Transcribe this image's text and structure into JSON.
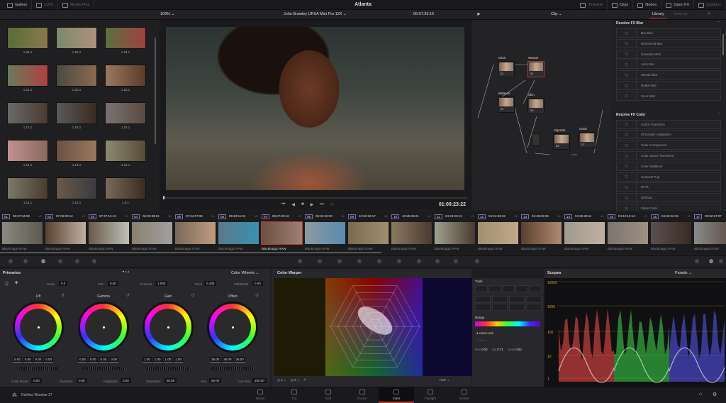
{
  "app": {
    "project_title": "Atlanta",
    "version_label": "DaVinci Resolve 17"
  },
  "top_left_tabs": [
    {
      "label": "Gallery",
      "icon": "gallery-icon"
    },
    {
      "label": "LUTs",
      "icon": "luts-icon"
    },
    {
      "label": "Media Pool",
      "icon": "media-pool-icon"
    }
  ],
  "top_right_tabs": [
    {
      "label": "Timeline",
      "icon": "timeline-icon"
    },
    {
      "label": "Clips",
      "icon": "clips-icon"
    },
    {
      "label": "Nodes",
      "icon": "nodes-icon"
    },
    {
      "label": "Open FX",
      "icon": "openfx-icon"
    },
    {
      "label": "Lightbox",
      "icon": "lightbox-icon"
    }
  ],
  "viewer": {
    "zoom": "109%",
    "clip_title": "John Brawley URSA Mini Pro 12K",
    "source_timecode": "06:07:39:16",
    "record_timecode": "01:00:23:22"
  },
  "node_editor": {
    "mode": "Clip",
    "nodes": [
      {
        "label": "Glow",
        "id": "01"
      },
      {
        "label": "Warper",
        "id": "02"
      },
      {
        "label": "Balance",
        "id": "04"
      },
      {
        "label": "Skin",
        "id": "03"
      },
      {
        "label": "Vignette",
        "id": "06"
      },
      {
        "label": "Grain",
        "id": "07"
      }
    ]
  },
  "library": {
    "tabs": [
      "Library",
      "Settings"
    ],
    "active_tab": "Library",
    "sections": [
      {
        "title": "Resolve FX Blur",
        "items": [
          "Box Blur",
          "Directional Blur",
          "Gaussian Blur",
          "Lens Blur",
          "Mosaic Blur",
          "Radial Blur",
          "Zoom Blur"
        ]
      },
      {
        "title": "Resolve FX Color",
        "items": [
          "ACES Transform",
          "Chromatic Adaptation",
          "Color Compressor",
          "Color Space Transform",
          "Color Stabilizer",
          "Contrast Pop",
          "DCTL",
          "Dehaze",
          "False Color"
        ]
      }
    ]
  },
  "gallery": {
    "stills": [
      "1.26.1",
      "1.25.1",
      "1.24.1",
      "1.21.1",
      "1.20.1",
      "1.19.1",
      "1.17.1",
      "1.16.1",
      "1.15.1",
      "1.14.1",
      "1.13.1",
      "1.12.1",
      "1.11.1",
      "1.10.1",
      "1.9.1"
    ]
  },
  "timeline": {
    "selected": "07",
    "clips": [
      {
        "num": "01",
        "tc": "06:37:04:08",
        "track": "V1",
        "format": "Blackmagic RAW"
      },
      {
        "num": "02",
        "tc": "07:02:09:12",
        "track": "V1",
        "format": "Blackmagic RAW"
      },
      {
        "num": "03",
        "tc": "07:47:11:13",
        "track": "V1",
        "format": "Blackmagic RAW"
      },
      {
        "num": "04",
        "tc": "06:09:38:01",
        "track": "V1",
        "format": "Blackmagic RAW"
      },
      {
        "num": "05",
        "tc": "07:34:07:08",
        "track": "V1",
        "format": "Blackmagic RAW"
      },
      {
        "num": "06",
        "tc": "06:29:11:01",
        "track": "V1",
        "format": "Blackmagic RAW"
      },
      {
        "num": "07",
        "tc": "06:07:09:16",
        "track": "V1",
        "format": "Blackmagic RAW"
      },
      {
        "num": "08",
        "tc": "05:33:22:00",
        "track": "V1",
        "format": "Blackmagic RAW"
      },
      {
        "num": "09",
        "tc": "10:02:33:17",
        "track": "V1",
        "format": "Blackmagic RAW"
      },
      {
        "num": "10",
        "tc": "10:25:39:21",
        "track": "V1",
        "format": "Blackmagic RAW"
      },
      {
        "num": "11",
        "tc": "04:24:00:13",
        "track": "V1",
        "format": "Blackmagic RAW"
      },
      {
        "num": "12",
        "tc": "04:24:33:22",
        "track": "V1",
        "format": "Blackmagic RAW"
      },
      {
        "num": "13",
        "tc": "04:25:02:06",
        "track": "V1",
        "format": "Blackmagic RAW"
      },
      {
        "num": "14",
        "tc": "04:26:28:11",
        "track": "V1",
        "format": "Blackmagic RAW"
      },
      {
        "num": "15",
        "tc": "04:13:12:14",
        "track": "V1",
        "format": "Blackmagic RAW"
      },
      {
        "num": "16",
        "tc": "04:56:32:15",
        "track": "V1",
        "format": "Blackmagic RAW"
      },
      {
        "num": "17",
        "tc": "05:52:37:07",
        "track": "V1",
        "format": "Blackmagic RAW"
      }
    ]
  },
  "primaries": {
    "title": "Primaries",
    "mode": "Color Wheels",
    "top_params": [
      {
        "label": "Temp",
        "value": "0.0"
      },
      {
        "label": "Tint",
        "value": "0.00"
      },
      {
        "label": "Contrast",
        "value": "1.000"
      },
      {
        "label": "Pivot",
        "value": "0.435"
      },
      {
        "label": "Mid/Detail",
        "value": "0.00"
      }
    ],
    "wheels": [
      {
        "label": "Lift",
        "values": [
          "0.00",
          "0.00",
          "0.00",
          "0.00"
        ]
      },
      {
        "label": "Gamma",
        "values": [
          "0.00",
          "0.00",
          "0.00",
          "0.00"
        ]
      },
      {
        "label": "Gain",
        "values": [
          "1.00",
          "1.00",
          "1.00",
          "1.00"
        ]
      },
      {
        "label": "Offset",
        "values": [
          "25.00",
          "25.00",
          "25.00"
        ]
      }
    ],
    "bottom_params": [
      {
        "label": "Color Boost",
        "value": "0.00"
      },
      {
        "label": "Shadows",
        "value": "0.00"
      },
      {
        "label": "Highlights",
        "value": "0.00"
      },
      {
        "label": "Saturation",
        "value": "50.00"
      },
      {
        "label": "Hue",
        "value": "50.00"
      },
      {
        "label": "Lum Mix",
        "value": "100.00"
      }
    ]
  },
  "color_warper": {
    "title": "Color Warper",
    "grid_a": "6",
    "grid_b": "6",
    "color_space": "HSP"
  },
  "tools": {
    "title": "Tools",
    "range_label": "Range",
    "auto_lock": "Auto Lock",
    "point_mode": "1 Point",
    "readouts": [
      {
        "label": "Hue",
        "value": "0.00"
      },
      {
        "label": "Sat",
        "value": "0.71"
      },
      {
        "label": "Luma",
        "value": "0.50"
      }
    ]
  },
  "scopes": {
    "title": "Scopes",
    "mode": "Parade",
    "y_ticks": [
      "10000",
      "1000",
      "100",
      "10",
      "1"
    ],
    "channel_colors": [
      "#ff4d4d",
      "#3ddc4a",
      "#5a5aff"
    ]
  },
  "pages": [
    {
      "label": "Media"
    },
    {
      "label": "Cut"
    },
    {
      "label": "Edit"
    },
    {
      "label": "Fusion"
    },
    {
      "label": "Color"
    },
    {
      "label": "Fairlight"
    },
    {
      "label": "Deliver"
    }
  ],
  "active_page": "Color",
  "colors": {
    "accent_red": "#c0392b",
    "panel": "#28282c",
    "background": "#1e1e21"
  }
}
